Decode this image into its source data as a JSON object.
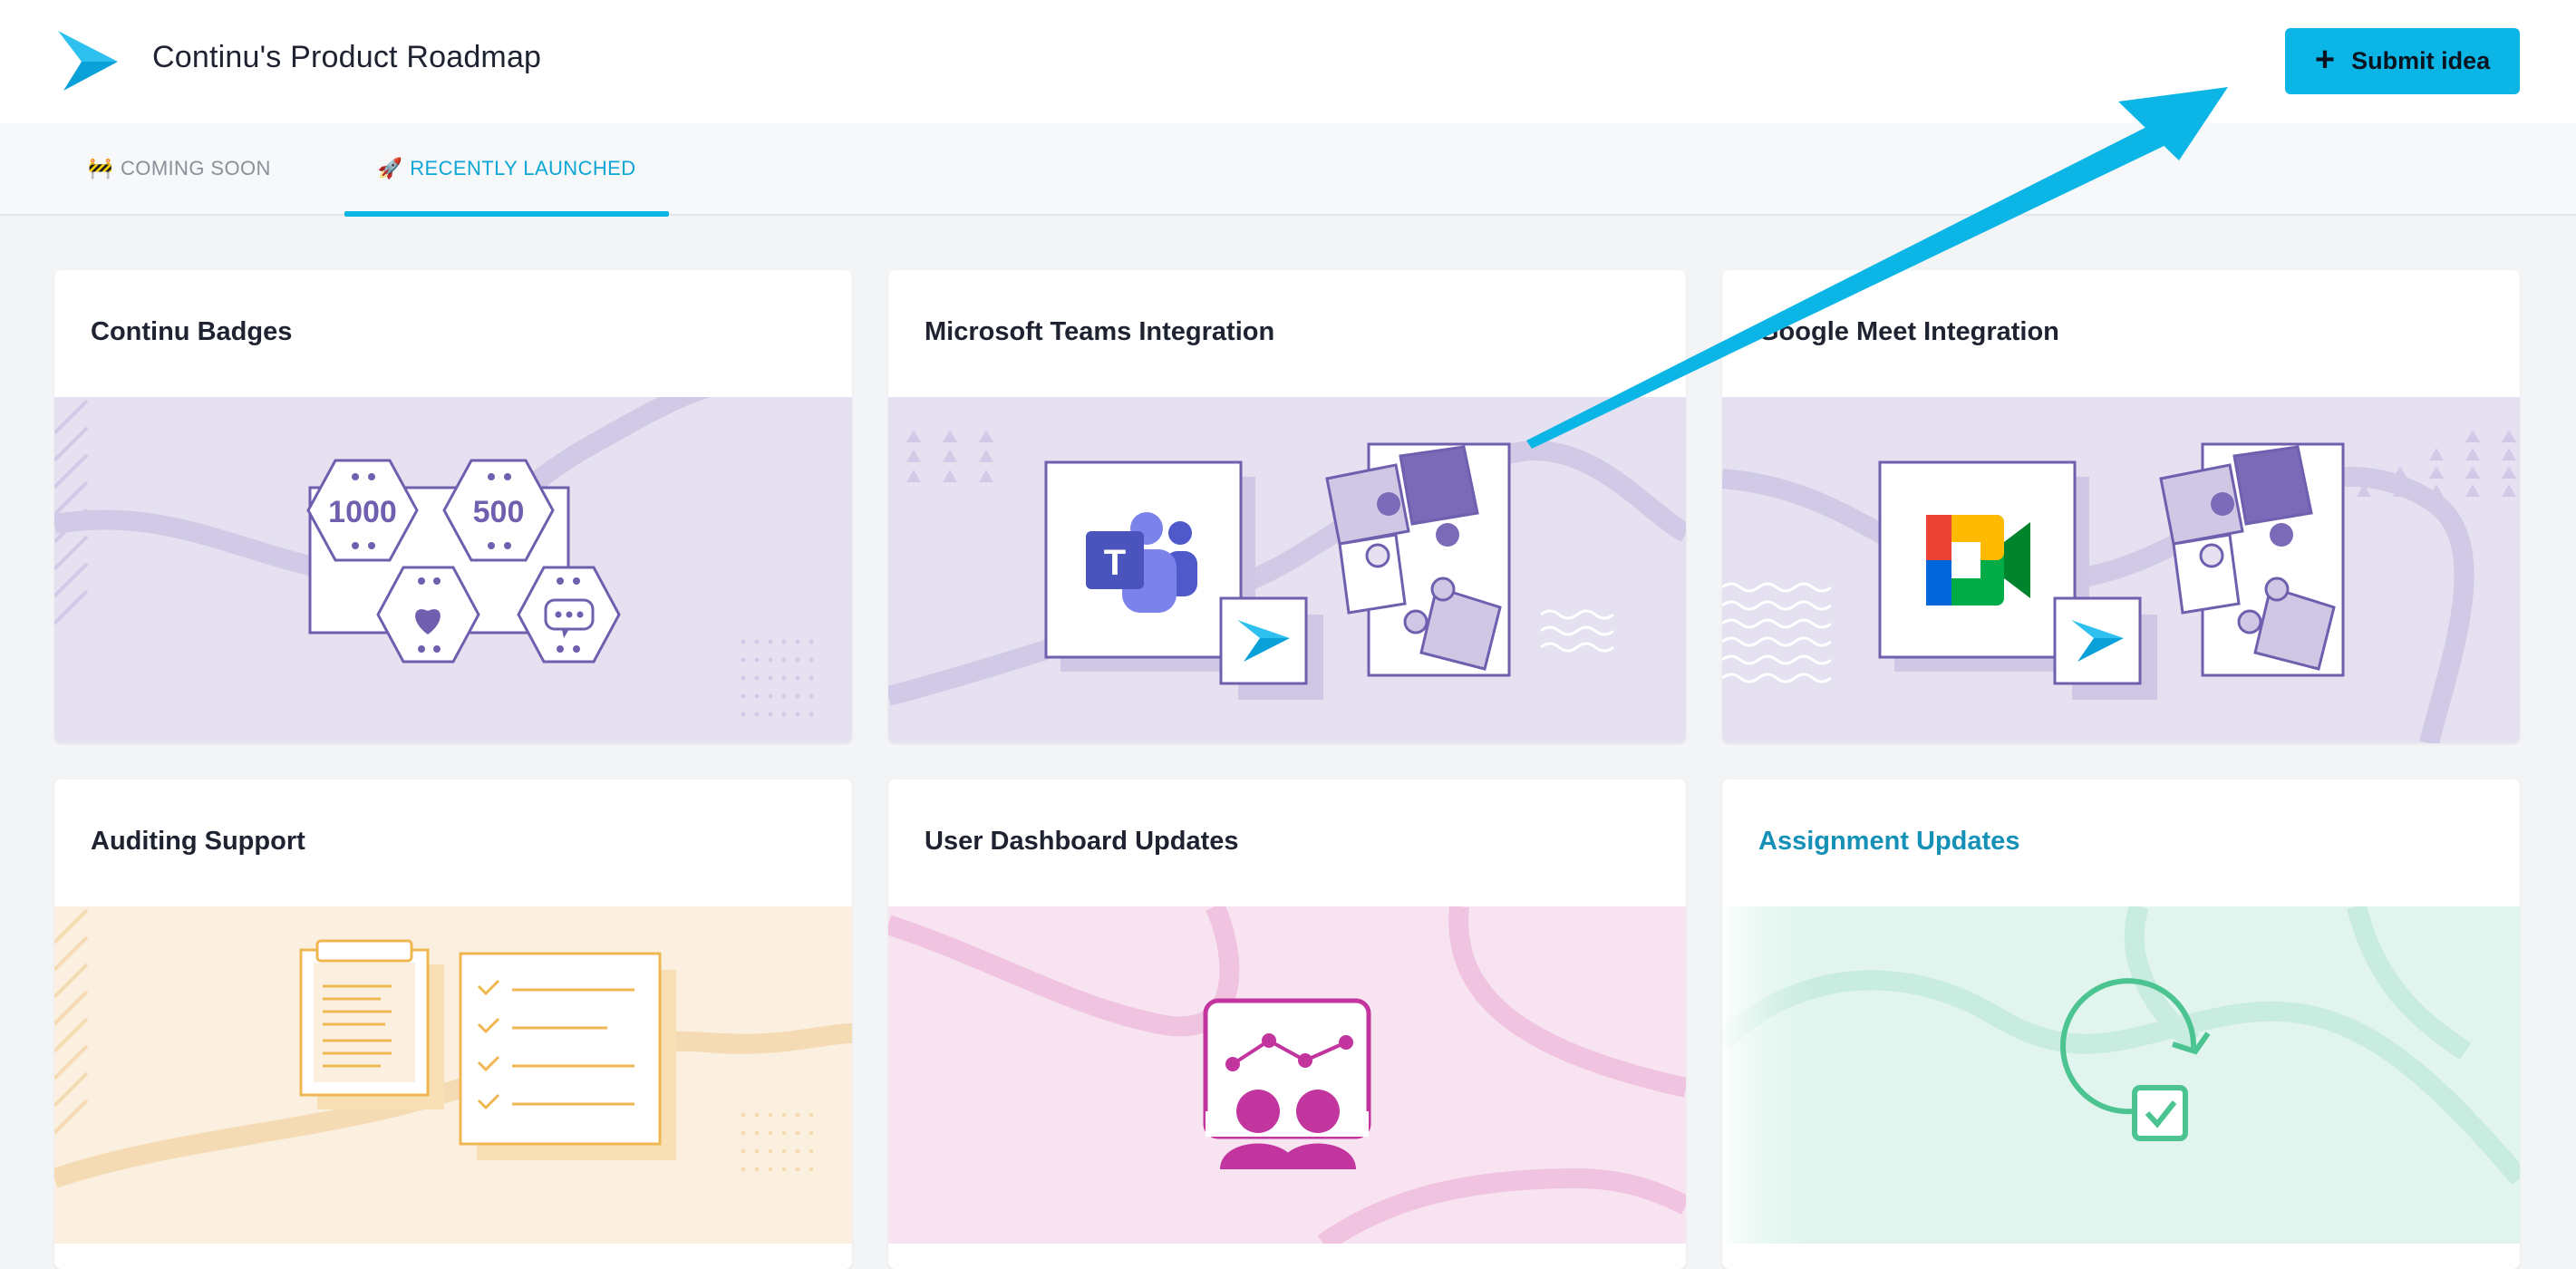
{
  "header": {
    "title": "Continu's Product Roadmap",
    "submit_label": "Submit idea",
    "submit_icon": "plus-icon"
  },
  "tabs": [
    {
      "emoji": "🚧",
      "label": "COMING SOON",
      "active": false
    },
    {
      "emoji": "🚀",
      "label": "RECENTLY LAUNCHED",
      "active": true
    }
  ],
  "cards": [
    {
      "title": "Continu Badges",
      "badges": [
        "1000",
        "500"
      ]
    },
    {
      "title": "Microsoft Teams Integration",
      "teams_letter": "T"
    },
    {
      "title": "Google Meet Integration"
    },
    {
      "title": "Auditing Support"
    },
    {
      "title": "User Dashboard Updates"
    },
    {
      "title": "Assignment Updates",
      "hovered": true
    }
  ],
  "colors": {
    "accent": "#0bb5e6",
    "purple_bg": "#e5e1f0",
    "purple_line": "#6f5fae",
    "orange_bg": "#fbf0df",
    "orange_line": "#f0b652",
    "pink_bg": "#f8e4f1",
    "pink_line": "#c2349e",
    "mint_bg": "#e1f5ee",
    "mint_line": "#4cc492"
  }
}
